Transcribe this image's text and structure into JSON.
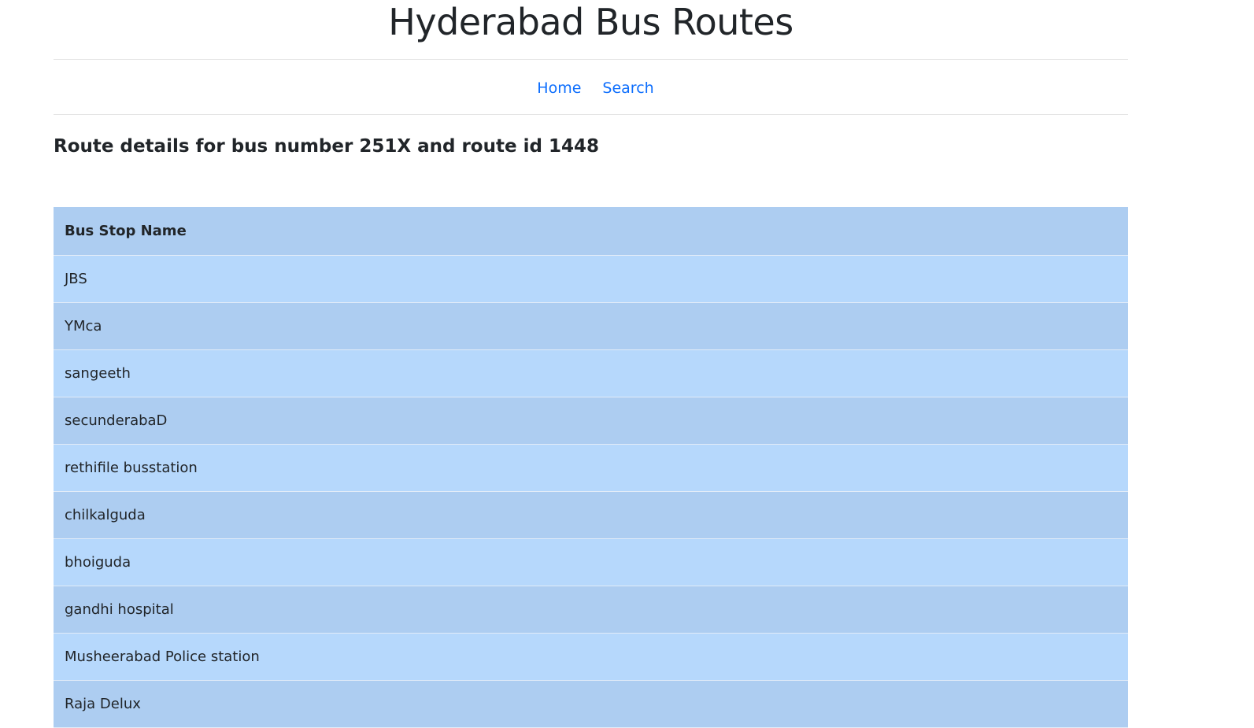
{
  "header": {
    "title": "Hyderabad Bus Routes"
  },
  "nav": {
    "home": "Home",
    "search": "Search"
  },
  "route": {
    "heading": "Route details for bus number 251X and route id 1448"
  },
  "table": {
    "column_header": "Bus Stop Name",
    "rows": [
      "JBS",
      "YMca",
      "sangeeth",
      "secunderabaD",
      "rethifile busstation",
      "chilkalguda",
      "bhoiguda",
      "gandhi hospital",
      "Musheerabad Police station",
      "Raja Delux"
    ]
  },
  "colors": {
    "link": "#0d6efd",
    "row_light": "#b6d8fc",
    "row_dark": "#adcdf1"
  }
}
